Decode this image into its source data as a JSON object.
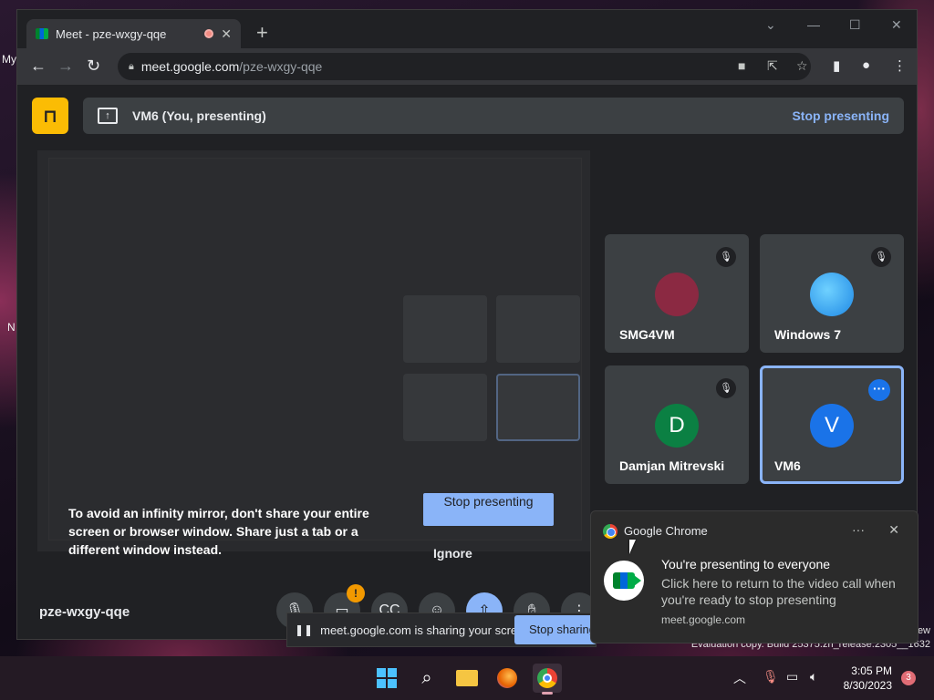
{
  "desktop": {
    "left_text": [
      "My",
      "N"
    ],
    "watermark_line1": "ew",
    "watermark_line2": "Evaluation copy. Build 25375.zn_release.2305__1632"
  },
  "browser": {
    "tab_title": "Meet - pze-wxgy-qqe",
    "url_host": "meet.google.com",
    "url_path": "/pze-wxgy-qqe"
  },
  "meet": {
    "presenting_label": "VM6 (You, presenting)",
    "stop_presenting_link": "Stop presenting",
    "infinity_warning": "To avoid an infinity mirror, don't share your entire screen or browser window. Share just a tab or a different window instead.",
    "stop_presenting_button": "Stop presenting",
    "ignore_button": "Ignore",
    "meeting_code": "pze-wxgy-qqe",
    "camera_badge": "!",
    "participants": [
      {
        "name": "SMG4VM",
        "initial": "",
        "avatar_color": "#8b2942",
        "muted": true
      },
      {
        "name": "Windows 7",
        "initial": "",
        "avatar_color": "#1e88e5",
        "muted": true
      },
      {
        "name": "Damjan Mitrevski",
        "initial": "D",
        "avatar_color": "#0b8043",
        "muted": true
      },
      {
        "name": "VM6",
        "initial": "V",
        "avatar_color": "#1a73e8",
        "muted": false
      }
    ]
  },
  "share_bar": {
    "message": "meet.google.com is sharing your screen.",
    "stop_button": "Stop sharing"
  },
  "notification": {
    "app_name": "Google Chrome",
    "title": "You're presenting to everyone",
    "body": "Click here to return to the video call when you're ready to stop presenting",
    "source": "meet.google.com"
  },
  "taskbar": {
    "time": "3:05 PM",
    "date": "8/30/2023",
    "badge_count": "3"
  }
}
